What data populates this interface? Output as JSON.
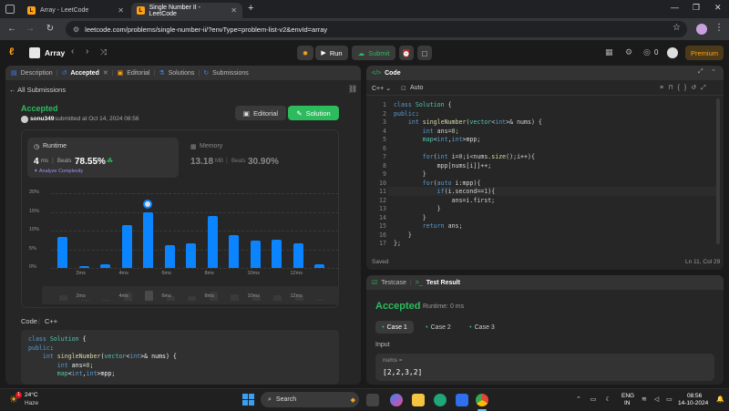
{
  "browser": {
    "tabs": [
      {
        "title": "Array - LeetCode"
      },
      {
        "title": "Single Number II - LeetCode"
      }
    ],
    "new_tab": "+",
    "url": "leetcode.com/problems/single-number-ii/?envType=problem-list-v2&envId=array"
  },
  "lcnav": {
    "list_title": "Array",
    "run_label": "Run",
    "submit_label": "Submit",
    "coins": "0",
    "premium_label": "Premium"
  },
  "left_tabs": [
    "Description",
    "Accepted",
    "Editorial",
    "Solutions",
    "Submissions"
  ],
  "submission": {
    "all_label": "All Submissions",
    "status": "Accepted",
    "user": "sonu349",
    "submitted_text": "submitted at Oct 14, 2024 08:56",
    "editorial_btn": "Editorial",
    "solution_btn": "Solution",
    "runtime_label": "Runtime",
    "runtime_value": "4",
    "runtime_unit": "ms",
    "beats_label": "Beats",
    "runtime_beats": "78.55%",
    "analyze_label": "Analyze Complexity",
    "memory_label": "Memory",
    "memory_value": "13.18",
    "memory_unit": "MB",
    "memory_beats": "30.90%"
  },
  "chart_data": {
    "type": "bar",
    "ylabel_ticks": [
      "20%",
      "15%",
      "10%",
      "5%",
      "0%"
    ],
    "ylim": [
      0,
      20
    ],
    "x_tick_labels": [
      "2ms",
      "4ms",
      "6ms",
      "8ms",
      "10ms",
      "12ms"
    ],
    "values": [
      8.3,
      0.6,
      0.9,
      11.5,
      15,
      6.1,
      6.6,
      14,
      8.7,
      7.3,
      7.5,
      6.6,
      1
    ],
    "highlight_index": 4
  },
  "code_section": {
    "label": "Code",
    "lang": "C++",
    "lines": [
      "class Solution {",
      "public:",
      "    int singleNumber(vector<int>& nums) {",
      "        int ans=0;",
      "        map<int,int>mpp;"
    ]
  },
  "editor": {
    "title": "Code",
    "lang": "C++",
    "mode": "Auto",
    "lines": [
      "class Solution {",
      "public:",
      "    int singleNumber(vector<int>& nums) {",
      "        int ans=0;",
      "        map<int,int>mpp;",
      "",
      "        for(int i=0;i<nums.size();i++){",
      "            mpp[nums[i]]++;",
      "        }",
      "        for(auto i:mpp){",
      "            if(i.second==1){",
      "                ans=i.first;",
      "            }",
      "        }",
      "        return ans;",
      "    }",
      "};"
    ],
    "line_numbers": [
      "1",
      "2",
      "3",
      "4",
      "5",
      "6",
      "7",
      "8",
      "9",
      "10",
      "11",
      "12",
      "13",
      "14",
      "15",
      "16",
      "17"
    ],
    "saved": "Saved",
    "cursor": "Ln 11, Col 29"
  },
  "results": {
    "testcase_tab": "Testcase",
    "result_tab": "Test Result",
    "status": "Accepted",
    "runtime": "Runtime: 0 ms",
    "cases": [
      "Case 1",
      "Case 2",
      "Case 3"
    ],
    "input_label": "Input",
    "param_name": "nums =",
    "param_value": "[2,2,3,2]"
  },
  "taskbar": {
    "temp": "24°C",
    "weather": "Haze",
    "search_placeholder": "Search",
    "lang1": "ENG",
    "lang2": "IN",
    "time": "08:56",
    "date": "14-10-2024",
    "notif_badge": "1"
  }
}
